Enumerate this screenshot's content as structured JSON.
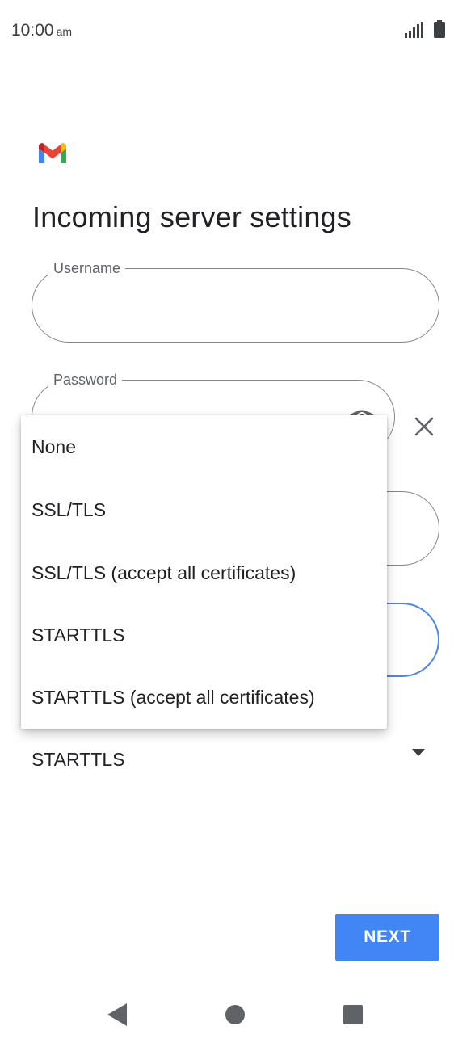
{
  "status_bar": {
    "time": "10:00",
    "meridiem": "am",
    "icons": [
      "signal-icon",
      "battery-icon"
    ]
  },
  "app": {
    "logo": "gmail-logo"
  },
  "page": {
    "title": "Incoming server settings"
  },
  "form": {
    "username_label": "Username",
    "username_value": "",
    "password_label": "Password",
    "password_value": "",
    "password_icons": [
      "visibility-icon",
      "clear-icon"
    ],
    "security_type_value": "STARTTLS"
  },
  "menu": {
    "items": [
      {
        "label": "None"
      },
      {
        "label": "SSL/TLS"
      },
      {
        "label": "SSL/TLS (accept all certificates)"
      },
      {
        "label": "STARTTLS"
      },
      {
        "label": "STARTTLS (accept all certificates)"
      }
    ]
  },
  "actions": {
    "next_label": "NEXT"
  },
  "nav_bar": {
    "icons": [
      "back-icon",
      "home-icon",
      "recents-icon"
    ]
  },
  "colors": {
    "accent": "#4285f4",
    "focus_outline": "#4a86e8",
    "outline": "#80868b",
    "text": "#202124"
  }
}
